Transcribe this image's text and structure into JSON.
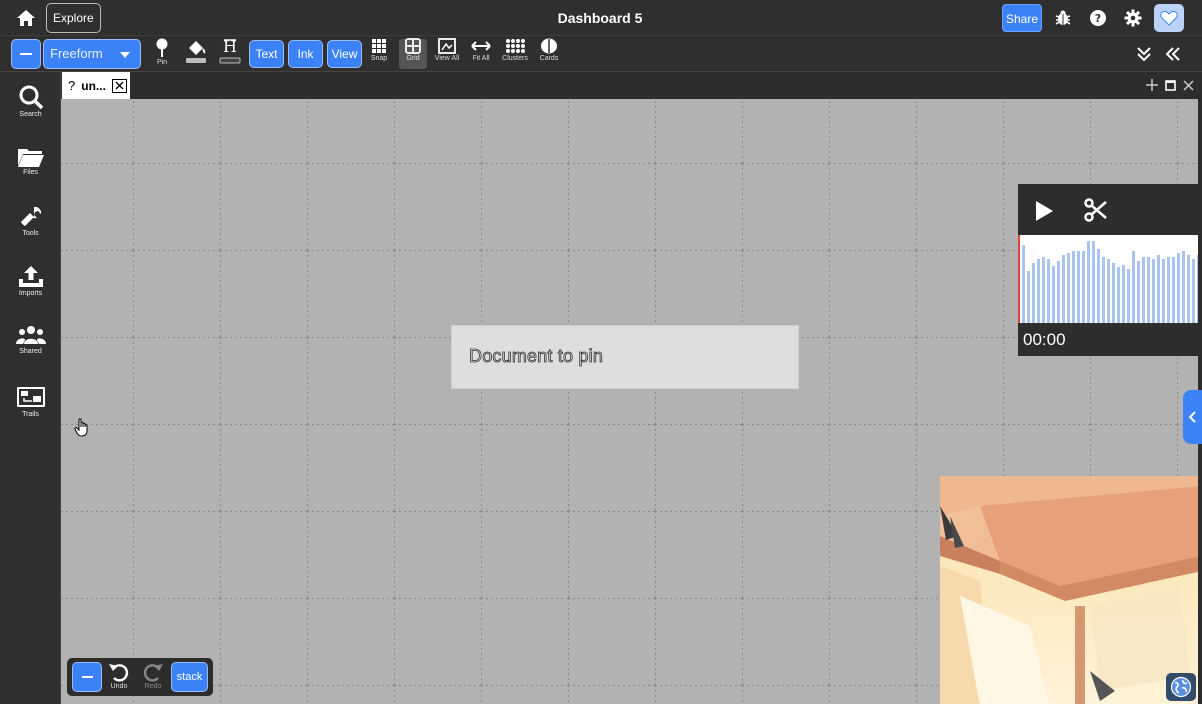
{
  "header": {
    "explore_label": "Explore",
    "title": "Dashboard 5",
    "share_label": "Share"
  },
  "toolbar": {
    "mode_value": "Freeform",
    "pin_label": "Pin",
    "text_label": "Text",
    "ink_label": "Ink",
    "view_label": "View",
    "snap_label": "Snap",
    "grid_label": "Grid",
    "view_all_label": "View All",
    "fit_all_label": "Fit All",
    "clusters_label": "Clusters",
    "cards_label": "Cards"
  },
  "sidebar": {
    "items": [
      {
        "label": "Search",
        "icon": "search-icon"
      },
      {
        "label": "Files",
        "icon": "folder-icon"
      },
      {
        "label": "Tools",
        "icon": "wrench-icon"
      },
      {
        "label": "Imports",
        "icon": "upload-icon"
      },
      {
        "label": "Shared",
        "icon": "users-icon"
      },
      {
        "label": "Trails",
        "icon": "trails-icon"
      }
    ]
  },
  "tab": {
    "question_mark": "?",
    "name": "un..."
  },
  "canvas": {
    "document_text": "Document to pin"
  },
  "audio": {
    "time": "00:00"
  },
  "bottom": {
    "undo_label": "Undo",
    "redo_label": "Redo",
    "stack_label": "stack"
  },
  "colors": {
    "accent": "#3b82f6",
    "chrome": "#2f2f2f",
    "canvas": "#b2b2b2"
  }
}
